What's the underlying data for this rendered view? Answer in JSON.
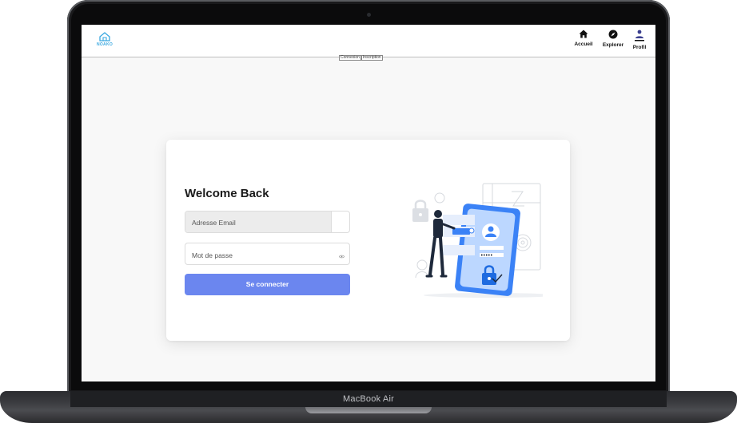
{
  "device": {
    "label": "MacBook Air"
  },
  "app": {
    "logo_text": "NOAKO",
    "nav": [
      {
        "label": "Accueil",
        "icon": "home-icon"
      },
      {
        "label": "Explorer",
        "icon": "compass-icon"
      },
      {
        "label": "Profil",
        "icon": "user-icon"
      }
    ],
    "tabs": [
      "Connexion",
      "Inscription"
    ]
  },
  "login": {
    "title": "Welcome Back",
    "email_placeholder": "Adresse Email",
    "password_placeholder": "Mot de passe",
    "submit_label": "Se connecter"
  },
  "colors": {
    "accent": "#6b86ef",
    "logo": "#3aa8e0",
    "illustration_blue": "#3b82f6",
    "phone_dark": "#1e293b"
  }
}
